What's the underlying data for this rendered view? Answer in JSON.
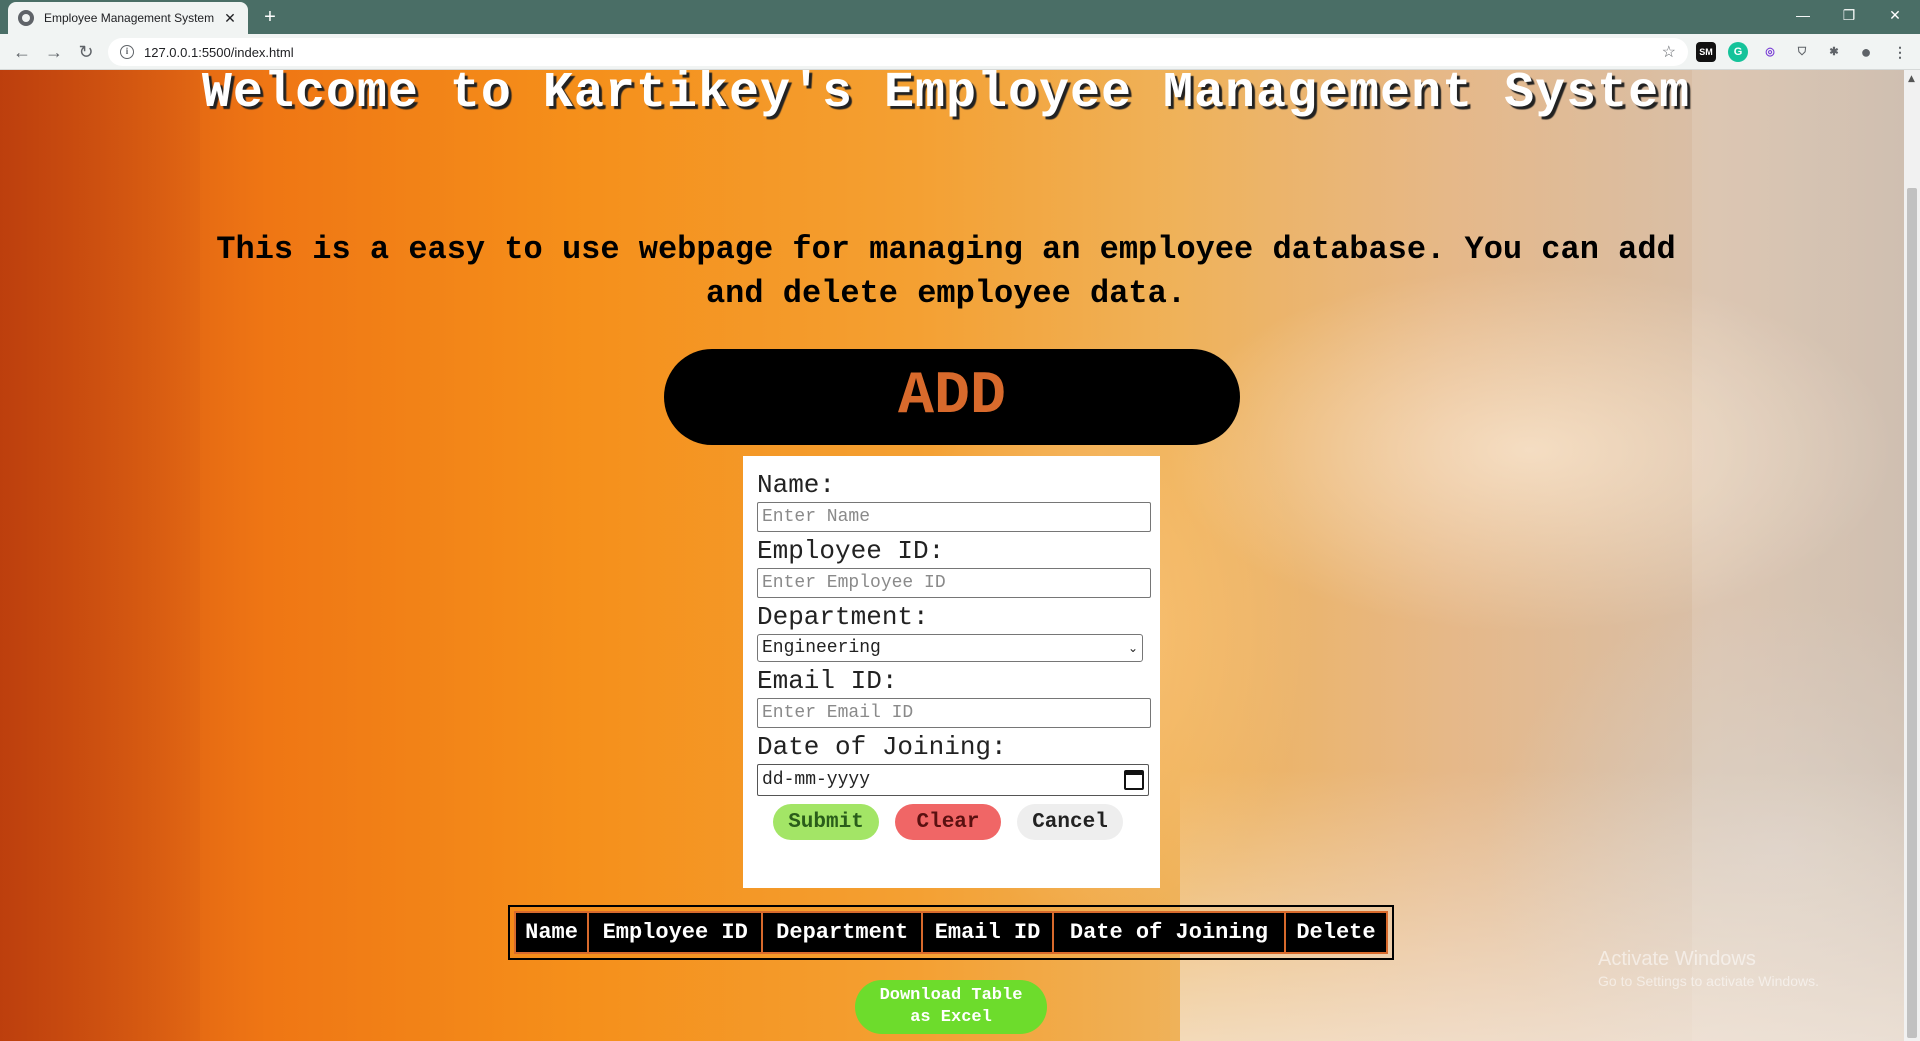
{
  "browser": {
    "tab_title": "Employee Management System",
    "tab_close": "✕",
    "new_tab": "+",
    "url": "127.0.0.1:5500/index.html",
    "window_controls": [
      "—",
      "❐",
      "✕"
    ],
    "extensions": [
      "SM",
      "G",
      "◎",
      "⛉",
      "✱",
      "●"
    ]
  },
  "page": {
    "title": "Welcome to Kartikey's Employee Management System",
    "subtitle": "This is a easy to use webpage for managing an employee database. You can add and delete employee data.",
    "add_label": "ADD"
  },
  "form": {
    "name_label": "Name:",
    "name_placeholder": "Enter Name",
    "employee_id_label": "Employee ID:",
    "employee_id_placeholder": "Enter Employee ID",
    "department_label": "Department:",
    "department_selected": "Engineering",
    "email_label": "Email ID:",
    "email_placeholder": "Enter Email ID",
    "doj_label": "Date of Joining:",
    "doj_placeholder": "dd-mm-yyyy",
    "submit_label": "Submit",
    "clear_label": "Clear",
    "cancel_label": "Cancel"
  },
  "table": {
    "columns": [
      "Name",
      "Employee ID",
      "Department",
      "Email ID",
      "Date of Joining",
      "Delete"
    ]
  },
  "download_label_line1": "Download Table",
  "download_label_line2": "as Excel",
  "watermark": {
    "line1": "Activate Windows",
    "line2": "Go to Settings to activate Windows."
  },
  "colors": {
    "chrome_tabbar": "#4a6e66",
    "accent_orange": "#d86a2c",
    "submit_green": "#a3e566",
    "clear_red": "#f06666",
    "download_green": "#6ddc2c"
  }
}
